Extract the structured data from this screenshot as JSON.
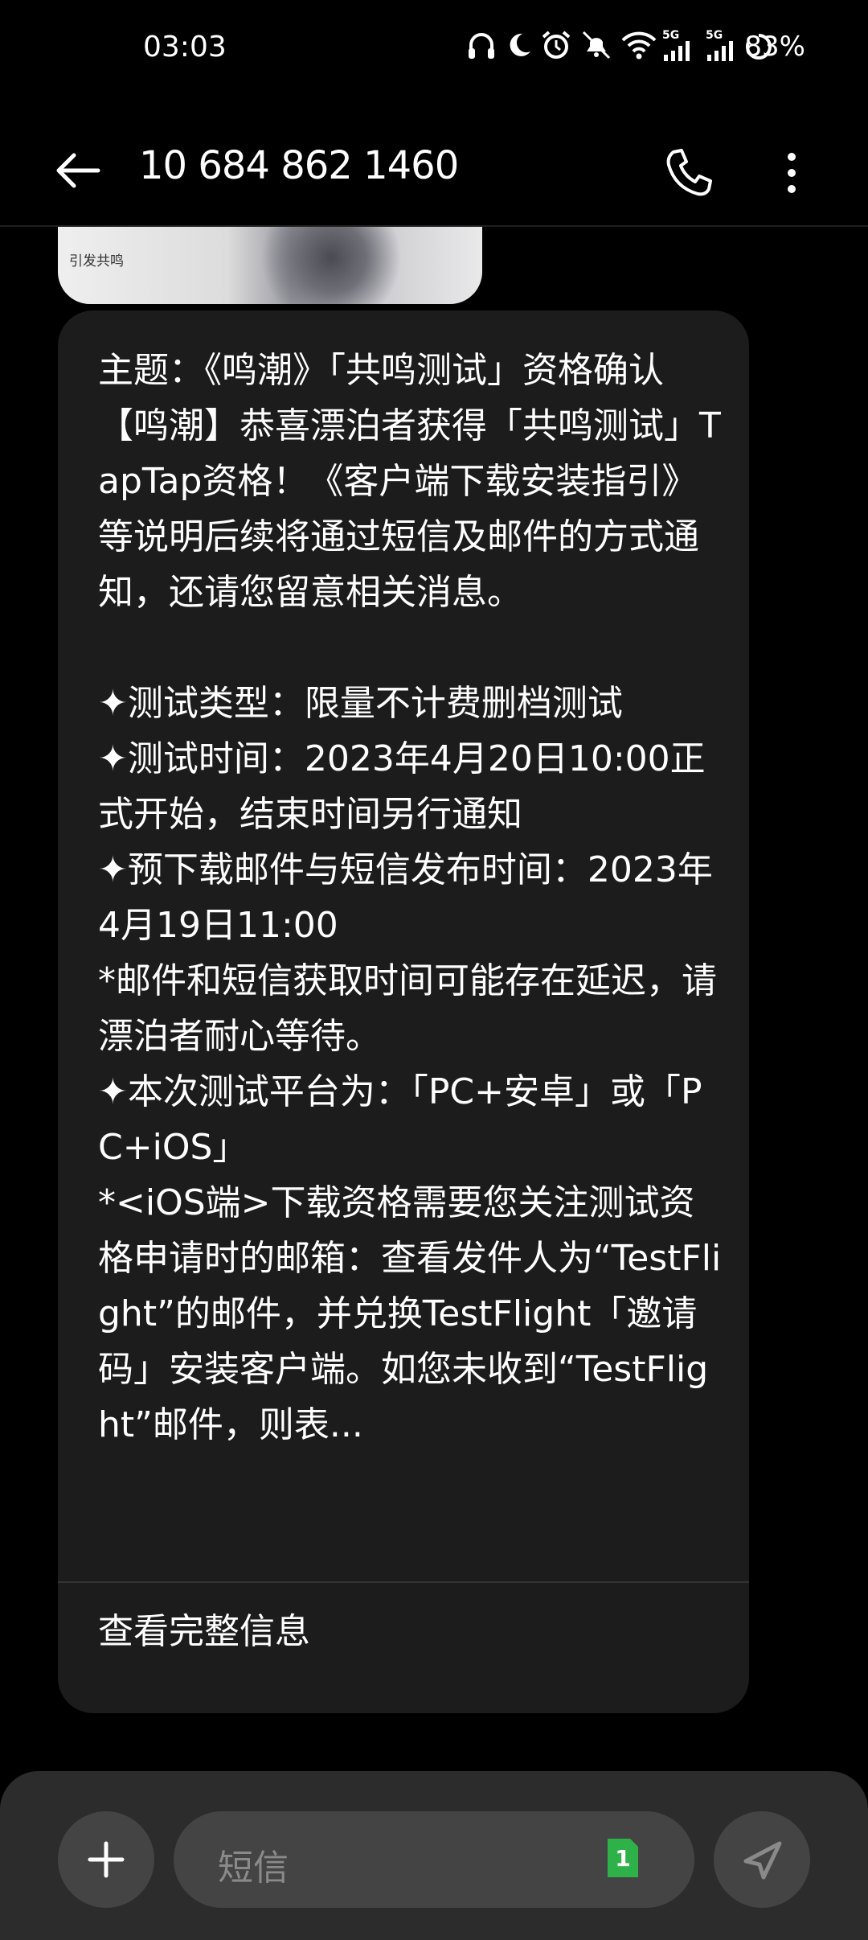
{
  "status_bar": {
    "time": "03:03",
    "battery_percent": "83%",
    "network_1": "5G",
    "network_2": "5G",
    "icons": [
      "headphones-icon",
      "moon-icon",
      "alarm-icon",
      "mute-icon",
      "wifi-icon",
      "signal-icon",
      "signal-icon",
      "battery-icon"
    ]
  },
  "header": {
    "title": "10 684 862 1460",
    "back_icon": "arrow-back-icon",
    "call_icon": "phone-icon",
    "more_icon": "more-vert-icon"
  },
  "image_message": {
    "caption": "引发共鸣"
  },
  "message": {
    "body": "主题：《鸣潮》「共鸣测试」资格确认\n【鸣潮】恭喜漂泊者获得「共鸣测试」TapTap资格！《客户端下载安装指引》等说明后续将通过短信及邮件的方式通知，还请您留意相关消息。\n\n✦测试类型：限量不计费删档测试\n✦测试时间：2023年4月20日10:00正式开始，结束时间另行通知\n✦预下载邮件与短信发布时间：2023年4月19日11:00\n*邮件和短信获取时间可能存在延迟，请漂泊者耐心等待。\n✦本次测试平台为：「PC+安卓」或「PC+iOS」\n*<iOS端>下载资格需要您关注测试资格申请时的邮箱：查看发件人为“TestFlight”的邮件，并兑换TestFlight「邀请码」安装客户端。如您未收到“TestFlight”邮件，则表...",
    "view_full_label": "查看完整信息"
  },
  "composer": {
    "placeholder": "短信",
    "sim_badge": "1",
    "add_icon": "plus-icon",
    "send_icon": "send-icon"
  },
  "colors": {
    "background": "#000000",
    "bubble": "#1c1c1c",
    "composer": "#2c2c2c",
    "button": "#444444",
    "sim_badge": "#2fb14a"
  }
}
